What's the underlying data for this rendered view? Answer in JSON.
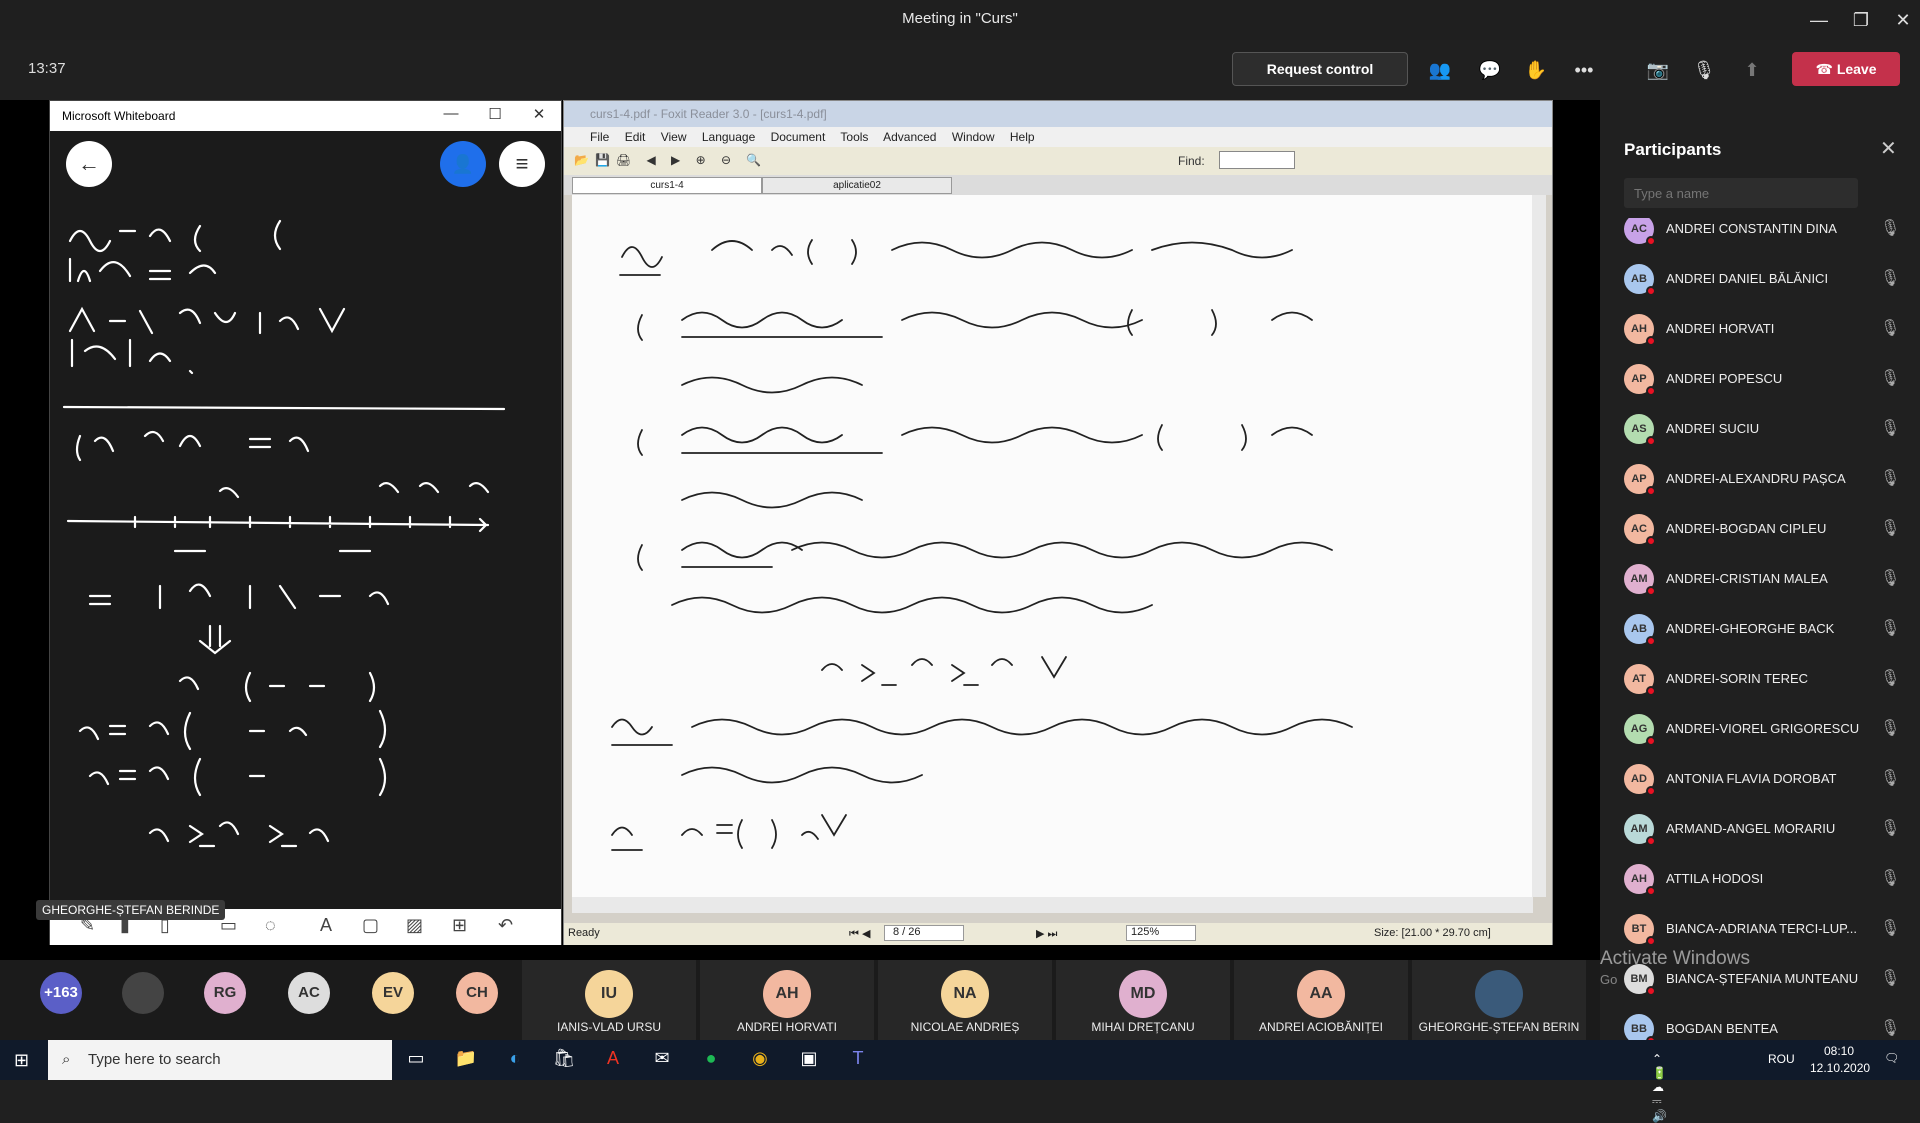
{
  "window": {
    "title": "Meeting in \"Curs\""
  },
  "callbar": {
    "clock": "13:37",
    "request_control": "Request control",
    "leave": "Leave"
  },
  "whiteboard": {
    "title": "Microsoft Whiteboard",
    "presenter": "GHEORGHE-ȘTEFAN BERINDE"
  },
  "foxit": {
    "title": "curs1-4.pdf - Foxit Reader 3.0 - [curs1-4.pdf]",
    "menu": [
      "File",
      "Edit",
      "View",
      "Language",
      "Document",
      "Tools",
      "Advanced",
      "Window",
      "Help"
    ],
    "find_label": "Find:",
    "tabs": [
      "curs1-4",
      "aplicatie02"
    ],
    "status_left": "Ready",
    "page": "8 / 26",
    "zoom": "125%",
    "size": "Size: [21.00 * 29.70 cm]"
  },
  "participants": {
    "title": "Participants",
    "search_placeholder": "Type a name",
    "list": [
      {
        "initials": "AC",
        "name": "ANDREI CONSTANTIN DINA",
        "color": "#c8a2e8"
      },
      {
        "initials": "AB",
        "name": "ANDREI DANIEL BĂLĂNICI",
        "color": "#a9c7ee"
      },
      {
        "initials": "AH",
        "name": "ANDREI HORVATI",
        "color": "#f2b8a0"
      },
      {
        "initials": "AP",
        "name": "ANDREI POPESCU",
        "color": "#f2b8a0"
      },
      {
        "initials": "AS",
        "name": "ANDREI SUCIU",
        "color": "#b3dcb0"
      },
      {
        "initials": "AP",
        "name": "ANDREI-ALEXANDRU PAȘCA",
        "color": "#f2b8a0"
      },
      {
        "initials": "AC",
        "name": "ANDREI-BOGDAN CIPLEU",
        "color": "#f2b8a0"
      },
      {
        "initials": "AM",
        "name": "ANDREI-CRISTIAN MALEA",
        "color": "#e0b0cf"
      },
      {
        "initials": "AB",
        "name": "ANDREI-GHEORGHE BACK",
        "color": "#a9c7ee"
      },
      {
        "initials": "AT",
        "name": "ANDREI-SORIN TEREC",
        "color": "#f2b8a0"
      },
      {
        "initials": "AG",
        "name": "ANDREI-VIOREL GRIGORESCU",
        "color": "#b3dcb0"
      },
      {
        "initials": "AD",
        "name": "ANTONIA FLAVIA DOROBAT",
        "color": "#f2b8a0"
      },
      {
        "initials": "AM",
        "name": "ARMAND-ANGEL MORARIU",
        "color": "#b9d9d8"
      },
      {
        "initials": "AH",
        "name": "ATTILA HODOSI",
        "color": "#e0b0cf"
      },
      {
        "initials": "BT",
        "name": "BIANCA-ADRIANA TERCI-LUP...",
        "color": "#f2b8a0"
      },
      {
        "initials": "BM",
        "name": "BIANCA-ȘTEFANIA MUNTEANU",
        "color": "#dddddd"
      },
      {
        "initials": "BB",
        "name": "BOGDAN BENTEA",
        "color": "#a9c7ee"
      }
    ]
  },
  "strip": {
    "overflow": "+163",
    "small": [
      {
        "i": "RG",
        "color": "#e0b0cf"
      },
      {
        "i": "AC",
        "color": "#dddddd"
      },
      {
        "i": "EV",
        "color": "#f5d59a"
      },
      {
        "i": "CH",
        "color": "#f2b8a0"
      }
    ],
    "tiles": [
      {
        "i": "IU",
        "name": "IANIS-VLAD URSU",
        "color": "#f5d59a"
      },
      {
        "i": "AH",
        "name": "ANDREI HORVATI",
        "color": "#f2b8a0"
      },
      {
        "i": "NA",
        "name": "NICOLAE ANDRIEȘ",
        "color": "#f5d59a"
      },
      {
        "i": "MD",
        "name": "MIHAI DREȚCANU",
        "color": "#e0b0cf"
      },
      {
        "i": "AA",
        "name": "ANDREI ACIOBĂNIȚEI",
        "color": "#f2b8a0"
      },
      {
        "i": "",
        "name": "GHEORGHE-ȘTEFAN BERIN",
        "color": "#3a5a7a"
      }
    ]
  },
  "activation": {
    "line1": "Activate Windows",
    "line2": "Go"
  },
  "taskbar": {
    "search": "Type here to search",
    "lang": "ROU",
    "time": "08:10",
    "date": "12.10.2020"
  }
}
